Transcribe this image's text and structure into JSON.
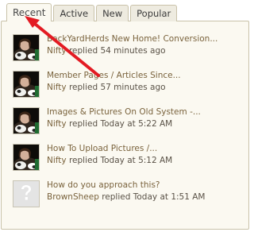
{
  "tabs": [
    {
      "label": "Recent",
      "active": true
    },
    {
      "label": "Active",
      "active": false
    },
    {
      "label": "New",
      "active": false
    },
    {
      "label": "Popular",
      "active": false
    }
  ],
  "topics": [
    {
      "title": "BackYardHerds New Home! Conversion...",
      "user": "Nifty",
      "action": "replied",
      "time": "54 minutes ago",
      "avatar": "goat-photo-avatar"
    },
    {
      "title": "Member Pages / Articles Since...",
      "user": "Nifty",
      "action": "replied",
      "time": "57 minutes ago",
      "avatar": "goat-photo-avatar"
    },
    {
      "title": "Images & Pictures On Old System -...",
      "user": "Nifty",
      "action": "replied",
      "time": "Today at 5:22 AM",
      "avatar": "goat-photo-avatar"
    },
    {
      "title": "How To Upload Pictures /...",
      "user": "Nifty",
      "action": "replied",
      "time": "Today at 5:12 AM",
      "avatar": "goat-photo-avatar"
    },
    {
      "title": "How do you approach this?",
      "user": "BrownSheep",
      "action": "replied",
      "time": "Today at 1:51 AM",
      "avatar": "placeholder-question-avatar"
    }
  ],
  "colors": {
    "panel_bg": "#fbf9f1",
    "tab_bg": "#eeebe0",
    "border": "#c9c2a9",
    "link": "#7a633d",
    "annotation_arrow": "#e31b23"
  }
}
